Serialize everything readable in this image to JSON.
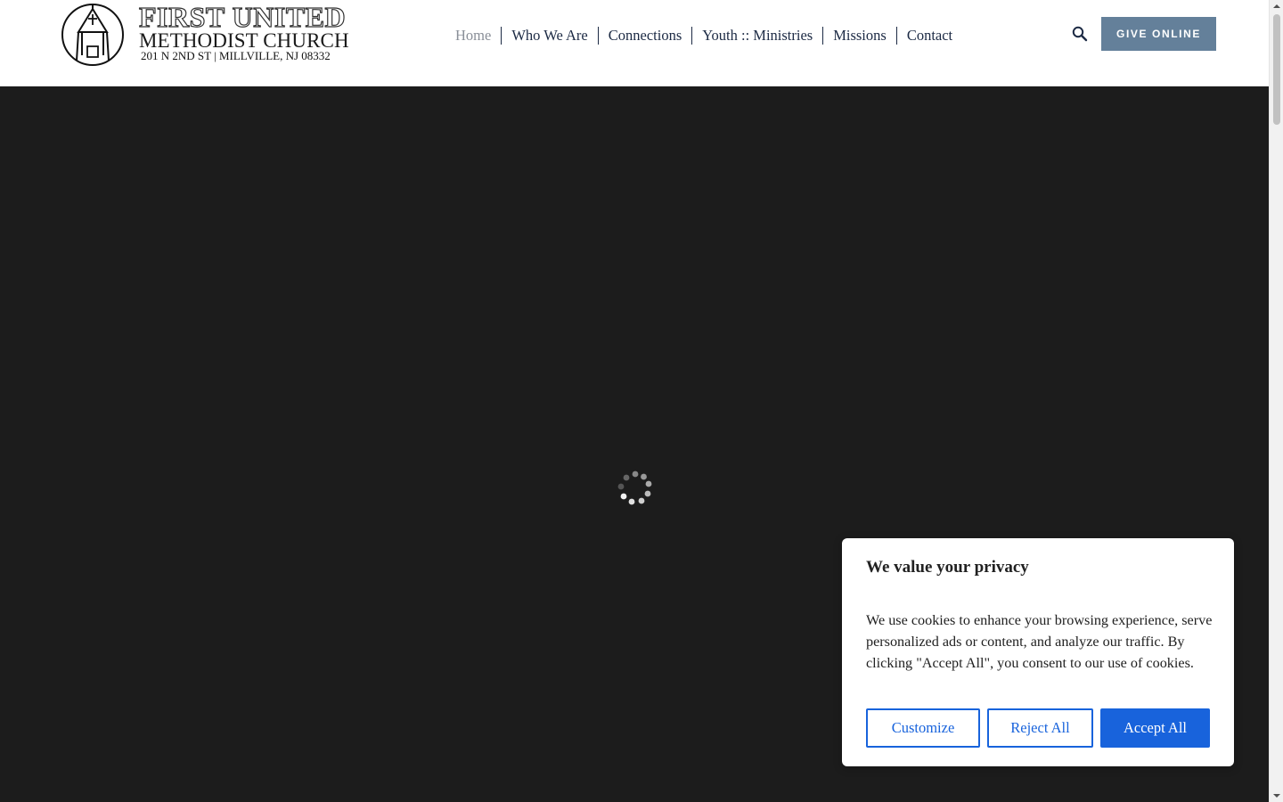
{
  "logo": {
    "line1": "FIRST UNITED",
    "line2": "METHODIST CHURCH",
    "line3": "201 N 2ND ST  |  MILLVILLE, NJ 08332",
    "icon": "steeple-circle-icon"
  },
  "nav": {
    "items": [
      {
        "label": "Home",
        "active": true
      },
      {
        "label": "Who We Are",
        "active": false
      },
      {
        "label": "Connections",
        "active": false
      },
      {
        "label": "Youth :: Ministries",
        "active": false
      },
      {
        "label": "Missions",
        "active": false
      },
      {
        "label": "Contact",
        "active": false
      }
    ],
    "search_icon": "search-icon",
    "give_label": "GIVE ONLINE"
  },
  "hero": {
    "state": "loading",
    "spinner_icon": "loading-spinner-icon"
  },
  "cookie": {
    "title": "We value your privacy",
    "text": "We use cookies to enhance your browsing experience, serve personalized ads or content, and analyze our traffic. By clicking \"Accept All\", you consent to our use of cookies.",
    "customize_label": "Customize",
    "reject_label": "Reject All",
    "accept_label": "Accept All"
  },
  "colors": {
    "nav_text": "#1c2a44",
    "nav_active": "#8a8f98",
    "give_button": "#64809a",
    "hero_bg": "#1c1c1c",
    "cookie_accent": "#1863dc"
  }
}
